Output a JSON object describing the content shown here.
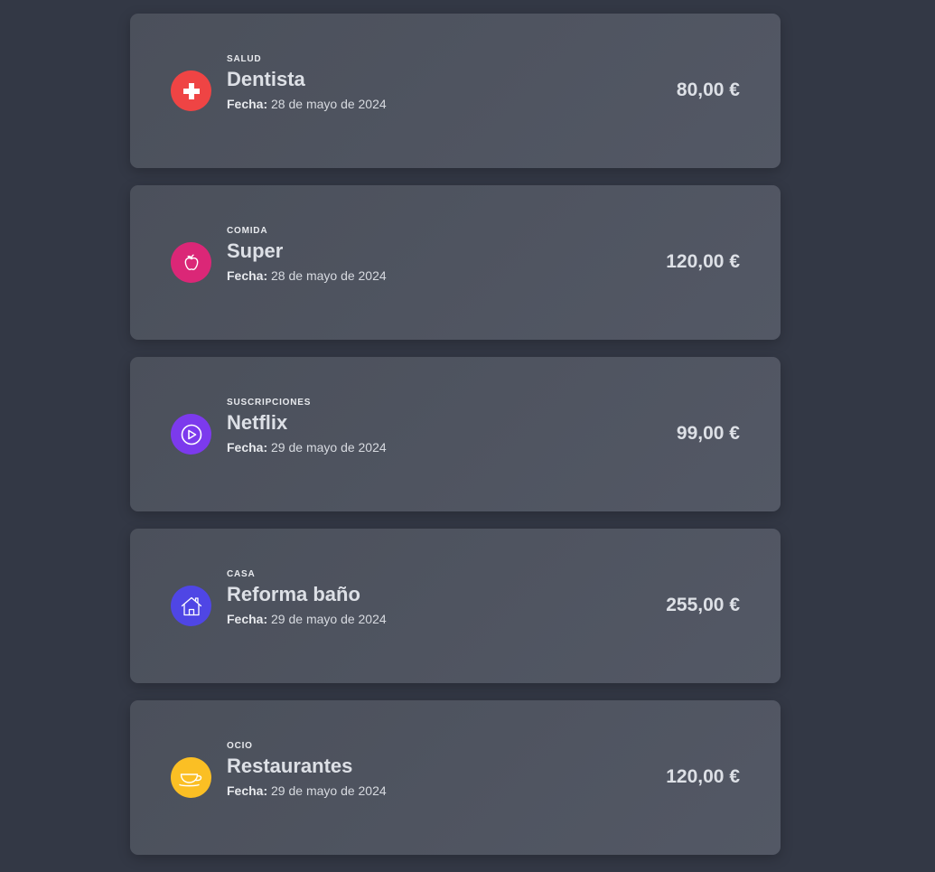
{
  "date_prefix": "Fecha:",
  "colors": {
    "background": "#333845",
    "card": "#4f5460",
    "salud": "#ef4444",
    "comida": "#db2777",
    "suscripciones": "#7c3aed",
    "casa": "#4f46e5",
    "ocio": "#fbbf24"
  },
  "expenses": [
    {
      "category": "SALUD",
      "title": "Dentista",
      "date": "28 de mayo de 2024",
      "amount": "80,00 €",
      "icon": "health-cross-icon",
      "color": "#ef4444"
    },
    {
      "category": "COMIDA",
      "title": "Super",
      "date": "28 de mayo de 2024",
      "amount": "120,00 €",
      "icon": "apple-icon",
      "color": "#db2777"
    },
    {
      "category": "SUSCRIPCIONES",
      "title": "Netflix",
      "date": "29 de mayo de 2024",
      "amount": "99,00 €",
      "icon": "play-circle-icon",
      "color": "#7c3aed"
    },
    {
      "category": "CASA",
      "title": "Reforma baño",
      "date": "29 de mayo de 2024",
      "amount": "255,00 €",
      "icon": "house-icon",
      "color": "#4f46e5"
    },
    {
      "category": "OCIO",
      "title": "Restaurantes",
      "date": "29 de mayo de 2024",
      "amount": "120,00 €",
      "icon": "coffee-cup-icon",
      "color": "#fbbf24"
    }
  ]
}
